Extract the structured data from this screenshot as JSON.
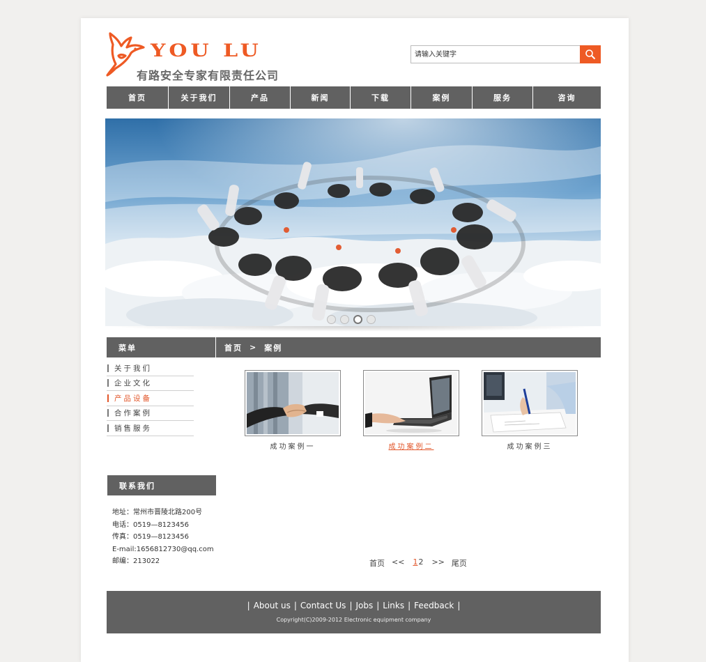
{
  "brand": {
    "name_en": "YOU LU",
    "name_cn": "有路安全专家有限责任公司",
    "accent_color": "#ee5a24"
  },
  "search": {
    "placeholder": "请输入关键字",
    "button_icon": "search-icon"
  },
  "nav": {
    "items": [
      "首页",
      "关于我们",
      "产品",
      "新闻",
      "下载",
      "案例",
      "服务",
      "咨询"
    ]
  },
  "banner": {
    "slides": 4,
    "active_slide": 3
  },
  "menu": {
    "title": "菜单",
    "items": [
      "关于我们",
      "企业文化",
      "产品设备",
      "合作案例",
      "销售服务"
    ],
    "active_index": 2
  },
  "breadcrumb": {
    "home": "首页",
    "separator": ">",
    "current": "案例"
  },
  "cases": [
    {
      "label": "成功案例一",
      "image": "handshake"
    },
    {
      "label": "成功案例二",
      "image": "laptop-typing"
    },
    {
      "label": "成功案例三",
      "image": "signing-document"
    }
  ],
  "contact": {
    "title": "联系我们",
    "lines": [
      "地址：常州市晋陵北路200号",
      "电话：0519—8123456",
      "传真：0519—8123456",
      "E-mail:1656812730@qq.com",
      "邮编：213022"
    ]
  },
  "pagination": {
    "first": "首页",
    "prev": "<<",
    "pages": [
      "1",
      "2"
    ],
    "current": "1",
    "next": ">>",
    "last": "尾页"
  },
  "footer": {
    "links": [
      "About us",
      "Contact Us",
      "Jobs",
      "Links",
      "Feedback"
    ],
    "separator": "|",
    "copyright": "Copyright(C)2009-2012 Electronic equipment company"
  },
  "colors": {
    "nav_bg": "#616161",
    "highlight": "#e2562a"
  }
}
